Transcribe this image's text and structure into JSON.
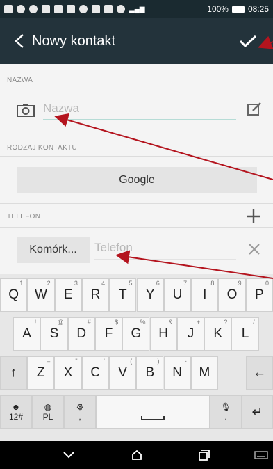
{
  "status_bar": {
    "battery": "100%",
    "time": "08:25"
  },
  "action_bar": {
    "title": "Nowy kontakt"
  },
  "form": {
    "name_section": "NAZWA",
    "name_placeholder": "Nazwa",
    "type_section": "RODZAJ KONTAKTU",
    "account": "Google",
    "phone_section": "TELEFON",
    "phone_type": "Komórk...",
    "phone_placeholder": "Telefon"
  },
  "keyboard": {
    "row1": [
      [
        "Q",
        "1"
      ],
      [
        "W",
        "2"
      ],
      [
        "E",
        "3"
      ],
      [
        "R",
        "4"
      ],
      [
        "T",
        "5"
      ],
      [
        "Y",
        "6"
      ],
      [
        "U",
        "7"
      ],
      [
        "I",
        "8"
      ],
      [
        "O",
        "9"
      ],
      [
        "P",
        "0"
      ]
    ],
    "row2": [
      [
        "A",
        "!"
      ],
      [
        "S",
        "@"
      ],
      [
        "D",
        "#"
      ],
      [
        "F",
        "$"
      ],
      [
        "G",
        "%"
      ],
      [
        "H",
        "&"
      ],
      [
        "J",
        "+"
      ],
      [
        "K",
        "?"
      ],
      [
        "L",
        "/"
      ]
    ],
    "row3": [
      [
        "Z",
        "–"
      ],
      [
        "X",
        "\""
      ],
      [
        "C",
        "'"
      ],
      [
        "V",
        "("
      ],
      [
        "B",
        ")"
      ],
      [
        "N",
        "-"
      ],
      [
        "M",
        ":"
      ]
    ],
    "row4": {
      "symbols": "12#",
      "lang": "PL",
      "comma": ",",
      "period": "."
    }
  },
  "colors": {
    "action_bar": "#23333b",
    "status_bar": "#1a2a30",
    "accent_line": "#b6dcd6",
    "arrow": "#b4141e"
  }
}
